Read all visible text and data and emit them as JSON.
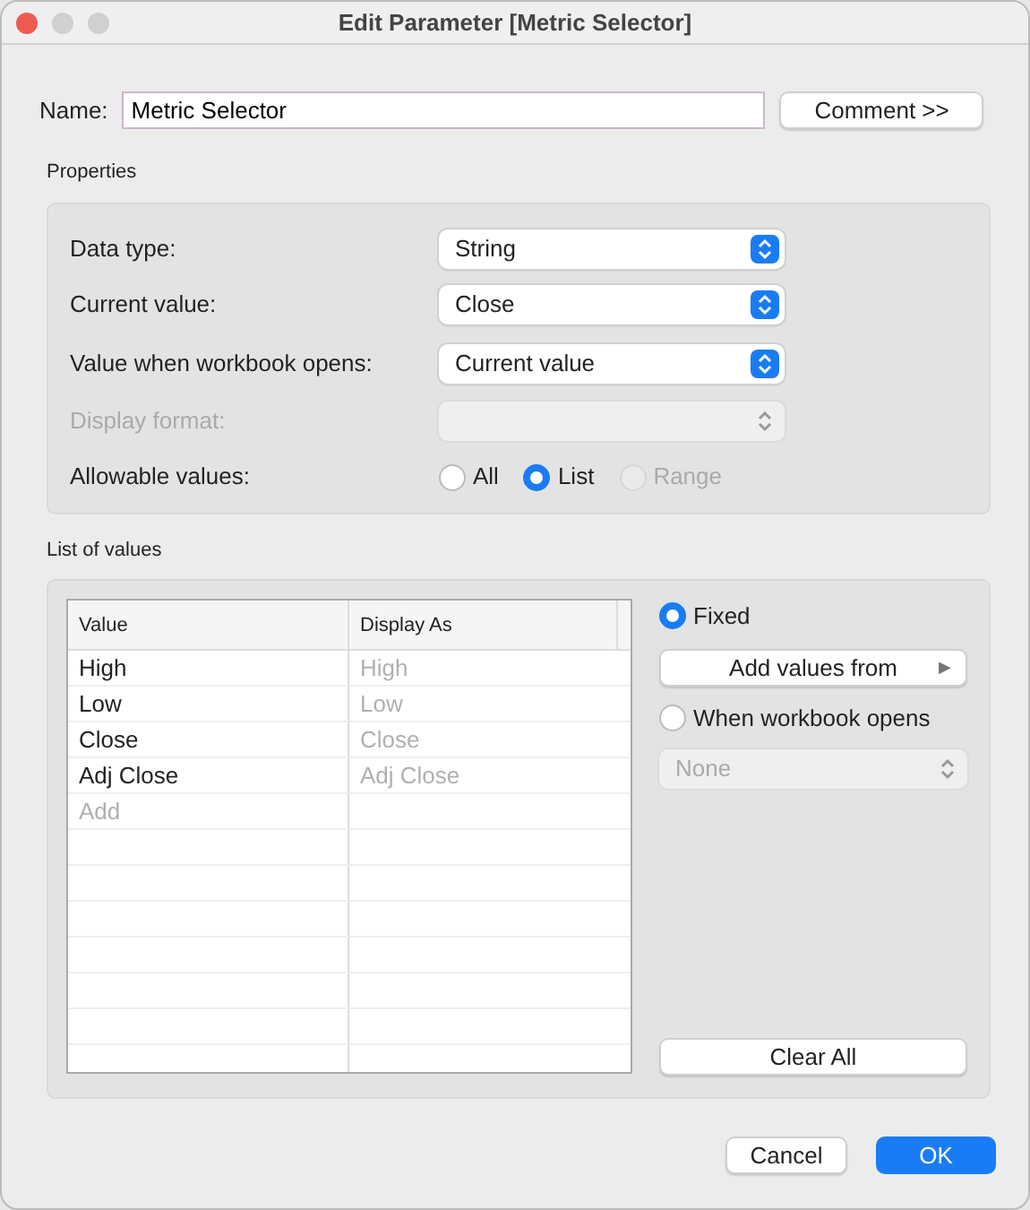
{
  "window": {
    "title": "Edit Parameter [Metric Selector]"
  },
  "name_field": {
    "label": "Name:",
    "value": "Metric Selector"
  },
  "comment_button": "Comment >>",
  "properties": {
    "title": "Properties",
    "rows": [
      {
        "kind": "select",
        "label": "Data type:",
        "value": "String",
        "disabled": false
      },
      {
        "kind": "select",
        "label": "Current value:",
        "value": "Close",
        "disabled": false
      },
      {
        "kind": "select",
        "label": "Value when workbook opens:",
        "value": "Current value",
        "disabled": false
      },
      {
        "kind": "select",
        "label": "Display format:",
        "disabled": true
      },
      {
        "kind": "radio",
        "label": "Allowable values:",
        "disabled": false,
        "options": [
          {
            "label": "All",
            "selected": false,
            "disabled": false
          },
          {
            "label": "List",
            "selected": true,
            "disabled": false
          },
          {
            "label": "Range",
            "selected": false,
            "disabled": true
          }
        ]
      }
    ]
  },
  "list_of_values": {
    "title": "List of values",
    "columns": [
      "Value",
      "Display As"
    ],
    "rows": [
      {
        "value": "High",
        "display": "High"
      },
      {
        "value": "Low",
        "display": "Low"
      },
      {
        "value": "Close",
        "display": "Close"
      },
      {
        "value": "Adj Close",
        "display": "Adj Close"
      }
    ],
    "add_row": "Add",
    "source_options": [
      {
        "label": "Fixed",
        "selected": true
      },
      {
        "label": "When workbook opens",
        "selected": false
      }
    ],
    "add_values_button": {
      "label": "Add values from",
      "arrow": "▶"
    },
    "when_opens_select": {
      "value": "None",
      "disabled": true
    },
    "clear_button": "Clear All"
  },
  "buttons": [
    {
      "label": "Cancel",
      "primary": false
    },
    {
      "label": "OK",
      "primary": true
    }
  ]
}
